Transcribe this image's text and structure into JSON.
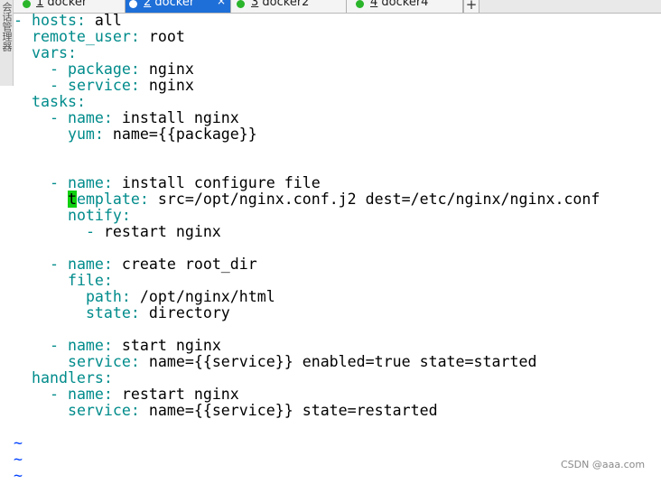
{
  "side_panel": {
    "label": "会话管理器"
  },
  "tabs": [
    {
      "num": "1",
      "name": "docker",
      "active": false
    },
    {
      "num": "2",
      "name": "docker",
      "active": true
    },
    {
      "num": "3",
      "name": "docker2",
      "active": false
    },
    {
      "num": "4",
      "name": "docker4",
      "active": false
    }
  ],
  "tab_close_glyph": "×",
  "new_tab_glyph": "+",
  "editor": {
    "cursor_char": "t",
    "lines": [
      [
        [
          "d",
          "- "
        ],
        [
          "k",
          "hosts"
        ],
        [
          "d",
          ":"
        ],
        [
          "t",
          " all"
        ]
      ],
      [
        [
          "t",
          "  "
        ],
        [
          "k",
          "remote_user"
        ],
        [
          "d",
          ":"
        ],
        [
          "t",
          " root"
        ]
      ],
      [
        [
          "t",
          "  "
        ],
        [
          "k",
          "vars"
        ],
        [
          "d",
          ":"
        ]
      ],
      [
        [
          "t",
          "    "
        ],
        [
          "d",
          "- "
        ],
        [
          "k",
          "package"
        ],
        [
          "d",
          ":"
        ],
        [
          "t",
          " nginx"
        ]
      ],
      [
        [
          "t",
          "    "
        ],
        [
          "d",
          "- "
        ],
        [
          "k",
          "service"
        ],
        [
          "d",
          ":"
        ],
        [
          "t",
          " nginx"
        ]
      ],
      [
        [
          "t",
          "  "
        ],
        [
          "k",
          "tasks"
        ],
        [
          "d",
          ":"
        ]
      ],
      [
        [
          "t",
          "    "
        ],
        [
          "d",
          "- "
        ],
        [
          "k",
          "name"
        ],
        [
          "d",
          ":"
        ],
        [
          "t",
          " install nginx"
        ]
      ],
      [
        [
          "t",
          "      "
        ],
        [
          "k",
          "yum"
        ],
        [
          "d",
          ":"
        ],
        [
          "t",
          " name={{package}}"
        ]
      ],
      [],
      [],
      [
        [
          "t",
          "    "
        ],
        [
          "d",
          "- "
        ],
        [
          "k",
          "name"
        ],
        [
          "d",
          ":"
        ],
        [
          "t",
          " install configure file"
        ]
      ],
      [
        [
          "t",
          "      "
        ],
        [
          "c",
          "t"
        ],
        [
          "k",
          "emplate"
        ],
        [
          "d",
          ":"
        ],
        [
          "t",
          " src=/opt/nginx.conf.j2 dest=/etc/nginx/nginx.conf"
        ]
      ],
      [
        [
          "t",
          "      "
        ],
        [
          "k",
          "notify"
        ],
        [
          "d",
          ":"
        ]
      ],
      [
        [
          "t",
          "        "
        ],
        [
          "d",
          "- "
        ],
        [
          "t",
          "restart nginx"
        ]
      ],
      [],
      [
        [
          "t",
          "    "
        ],
        [
          "d",
          "- "
        ],
        [
          "k",
          "name"
        ],
        [
          "d",
          ":"
        ],
        [
          "t",
          " create root_dir"
        ]
      ],
      [
        [
          "t",
          "      "
        ],
        [
          "k",
          "file"
        ],
        [
          "d",
          ":"
        ]
      ],
      [
        [
          "t",
          "        "
        ],
        [
          "k",
          "path"
        ],
        [
          "d",
          ":"
        ],
        [
          "t",
          " /opt/nginx/html"
        ]
      ],
      [
        [
          "t",
          "        "
        ],
        [
          "k",
          "state"
        ],
        [
          "d",
          ":"
        ],
        [
          "t",
          " directory"
        ]
      ],
      [],
      [
        [
          "t",
          "    "
        ],
        [
          "d",
          "- "
        ],
        [
          "k",
          "name"
        ],
        [
          "d",
          ":"
        ],
        [
          "t",
          " start nginx"
        ]
      ],
      [
        [
          "t",
          "      "
        ],
        [
          "k",
          "service"
        ],
        [
          "d",
          ":"
        ],
        [
          "t",
          " name={{service}} enabled=true state=started"
        ]
      ],
      [
        [
          "t",
          "  "
        ],
        [
          "k",
          "handlers"
        ],
        [
          "d",
          ":"
        ]
      ],
      [
        [
          "t",
          "    "
        ],
        [
          "d",
          "- "
        ],
        [
          "k",
          "name"
        ],
        [
          "d",
          ":"
        ],
        [
          "t",
          " restart nginx"
        ]
      ],
      [
        [
          "t",
          "      "
        ],
        [
          "k",
          "service"
        ],
        [
          "d",
          ":"
        ],
        [
          "t",
          " name={{service}} state=restarted"
        ]
      ],
      [],
      [
        [
          "~",
          "~"
        ]
      ],
      [
        [
          "~",
          "~"
        ]
      ],
      [
        [
          "~",
          "~"
        ]
      ]
    ]
  },
  "colors": {
    "key": "#008b8b",
    "text": "#000000",
    "tilde": "#0040ff",
    "cursor": "#10d010",
    "active_tab": "#1f6fd8"
  },
  "watermark": "CSDN @aaa.com"
}
